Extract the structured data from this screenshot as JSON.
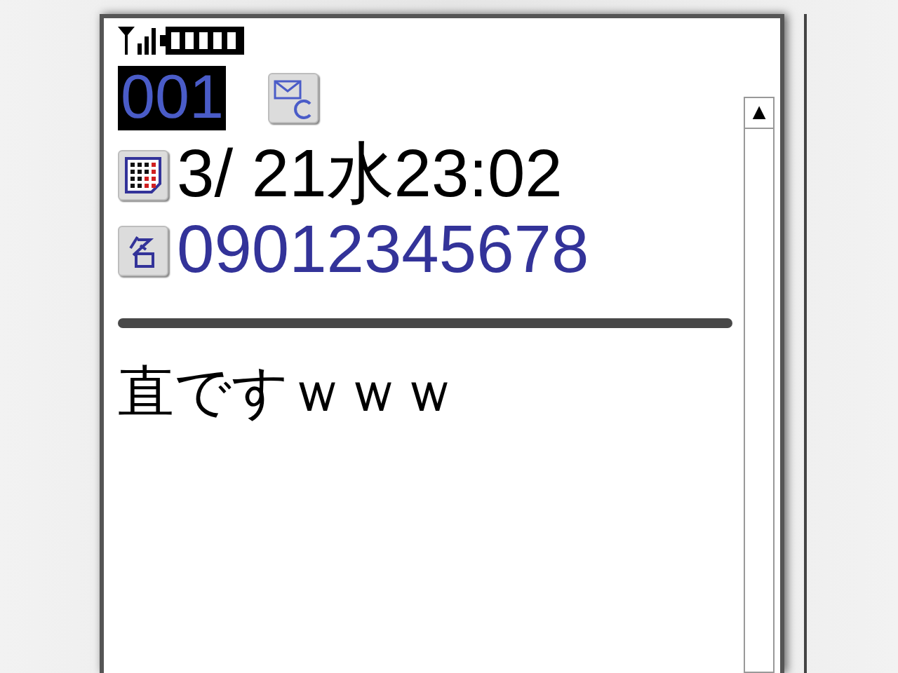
{
  "message": {
    "number": {
      "text": "001",
      "selected": true
    },
    "date": "3/ 21水23:02",
    "sender": "09012345678",
    "body": "直ですｗｗｗ"
  },
  "scrollbar": {
    "up_arrow": "▲"
  }
}
